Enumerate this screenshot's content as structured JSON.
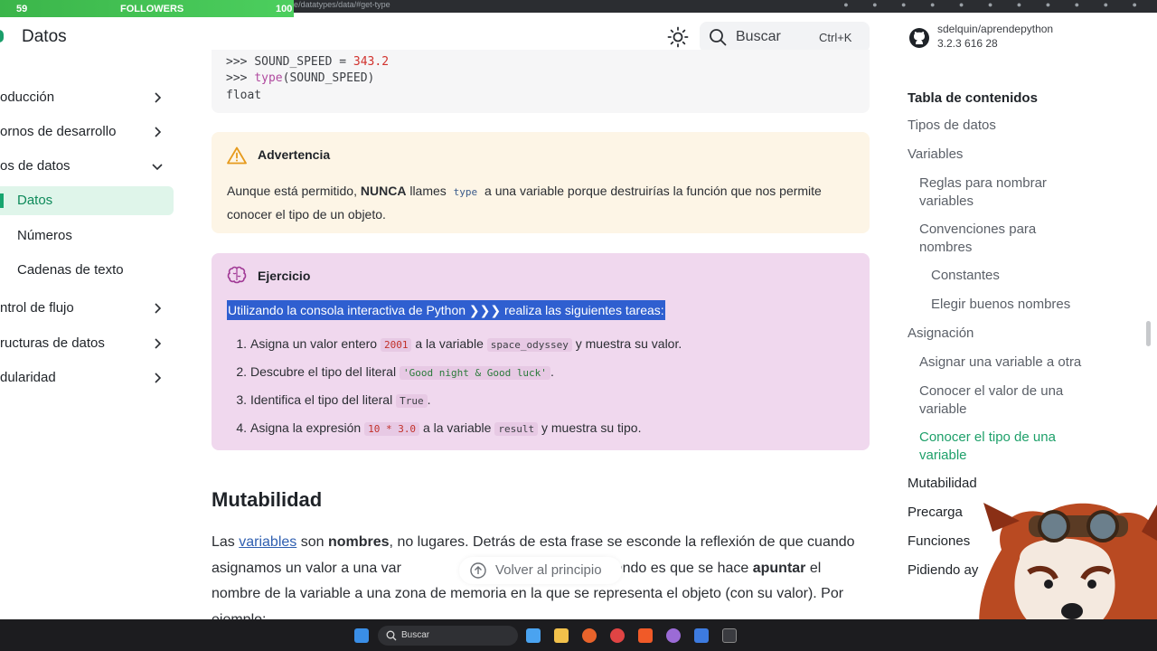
{
  "stream": {
    "left_count": "59",
    "label": "FOLLOWERS",
    "right_count": "100"
  },
  "browser": {
    "url": "aprendepython.es/core/datatypes/data/#get-type"
  },
  "header": {
    "site_title": "Datos",
    "search_label": "Buscar",
    "search_shortcut": "Ctrl+K",
    "repo_name": "sdelquin/aprendepython",
    "repo_stats": "3.2.3   616   28"
  },
  "sidebar": {
    "items": [
      {
        "label": "oducción"
      },
      {
        "label": "ornos de desarrollo"
      },
      {
        "label": "os de datos"
      },
      {
        "label": "Datos"
      },
      {
        "label": "Números"
      },
      {
        "label": "Cadenas de texto"
      },
      {
        "label": "ntrol de flujo"
      },
      {
        "label": "ructuras de datos"
      },
      {
        "label": "dularidad"
      }
    ]
  },
  "code": {
    "line1_prompt": ">>> ",
    "line1_name": "SOUND_SPEED = ",
    "line1_value": "343.2",
    "line2_prompt": ">>> ",
    "line2_func": "type",
    "line2_arg": "(SOUND_SPEED)",
    "line3": "float"
  },
  "warning": {
    "title": "Advertencia",
    "text_before": "Aunque está permitido, ",
    "text_bold": "NUNCA",
    "text_mid": " llames ",
    "code": "type",
    "text_after": " a una variable porque destruirías la función que nos permite conocer el tipo de un objeto."
  },
  "exercise": {
    "title": "Ejercicio",
    "intro": "Utilizando la consola interactiva de Python ❯❯❯ realiza las siguientes tareas:",
    "items": [
      {
        "n": "1.",
        "a": "Asigna un valor entero ",
        "code1": "2001",
        "b": " a la variable ",
        "code2": "space_odyssey",
        "c": " y muestra su valor."
      },
      {
        "n": "2.",
        "a": "Descubre el tipo del literal ",
        "code1": "'Good night & Good luck'",
        "b": "."
      },
      {
        "n": "3.",
        "a": "Identifica el tipo del literal ",
        "code1": "True",
        "b": "."
      },
      {
        "n": "4.",
        "a": "Asigna la expresión ",
        "code1": "10 * 3.0",
        "b": " a la variable ",
        "code2": "result",
        "c": " y muestra su tipo."
      }
    ]
  },
  "main": {
    "heading": "Mutabilidad",
    "p_a": "Las ",
    "p_link": "variables",
    "p_b": " son ",
    "p_bold1": "nombres",
    "p_c": ", no lugares. Detrás de esta frase se esconde la reflexión de que cuando asignamos un valor a una var",
    "p_d": "stá ocurriendo es que se hace ",
    "p_bold2": "apuntar",
    "p_e": " el nombre de la variable a una zona de memoria en la que se representa el objeto (con su valor). Por ejemplo:",
    "back_to_top": "Volver al principio"
  },
  "toc": {
    "title": "Tabla de contenidos",
    "items": [
      {
        "label": "Tipos de datos"
      },
      {
        "label": "Variables"
      },
      {
        "label": "Reglas para nombrar variables"
      },
      {
        "label": "Convenciones para nombres"
      },
      {
        "label": "Constantes"
      },
      {
        "label": "Elegir buenos nombres"
      },
      {
        "label": "Asignación"
      },
      {
        "label": "Asignar una variable a otra"
      },
      {
        "label": "Conocer el valor de una variable"
      },
      {
        "label": "Conocer el tipo de una variable"
      },
      {
        "label": "Mutabilidad"
      },
      {
        "label": "Precarga"
      },
      {
        "label": "Funciones"
      },
      {
        "label": "Pidiendo ay"
      }
    ]
  },
  "taskbar": {
    "search_label": "Buscar"
  },
  "colors": {
    "accent": "#17a56f",
    "selection": "#2f5fd0",
    "exercise_bg": "#f0d8ee",
    "warning_bg": "#fdf5e6"
  }
}
